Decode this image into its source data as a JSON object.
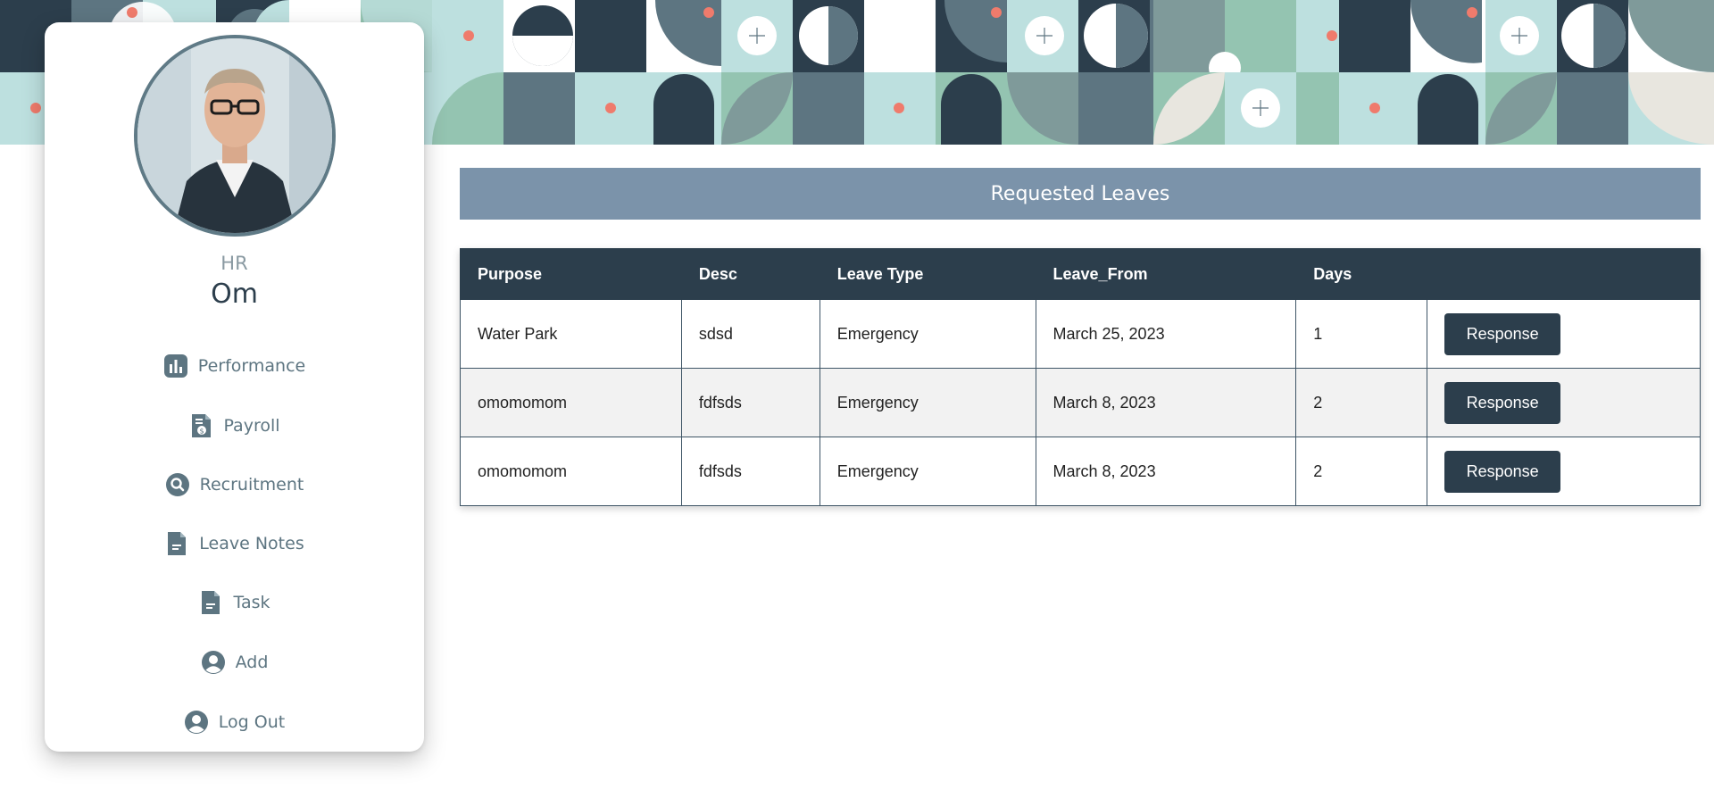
{
  "profile": {
    "role": "HR",
    "name": "Om",
    "avatar_icon": "user-photo"
  },
  "nav": {
    "items": [
      {
        "label": "Performance",
        "icon": "bar-chart-icon"
      },
      {
        "label": "Payroll",
        "icon": "invoice-icon"
      },
      {
        "label": "Recruitment",
        "icon": "search-icon"
      },
      {
        "label": "Leave Notes",
        "icon": "document-icon"
      },
      {
        "label": "Task",
        "icon": "document-icon"
      },
      {
        "label": "Add",
        "icon": "user-circle-icon"
      },
      {
        "label": "Log Out",
        "icon": "user-circle-icon"
      }
    ]
  },
  "main": {
    "title": "Requested Leaves",
    "table": {
      "columns": [
        "Purpose",
        "Desc",
        "Leave Type",
        "Leave_From",
        "Days",
        ""
      ],
      "rows": [
        {
          "purpose": "Water Park",
          "desc": "sdsd",
          "leave_type": "Emergency",
          "leave_from": "March 25, 2023",
          "days": "1",
          "action": "Response"
        },
        {
          "purpose": "omomomom",
          "desc": "fdfsds",
          "leave_type": "Emergency",
          "leave_from": "March 8, 2023",
          "days": "2",
          "action": "Response"
        },
        {
          "purpose": "omomomom",
          "desc": "fdfsds",
          "leave_type": "Emergency",
          "leave_from": "March 8, 2023",
          "days": "2",
          "action": "Response"
        }
      ]
    }
  },
  "colors": {
    "dark": "#2c3e4c",
    "title_bar": "#7b93aa",
    "nav_text": "#5d7581",
    "accent_dot": "#ef7b6c"
  }
}
